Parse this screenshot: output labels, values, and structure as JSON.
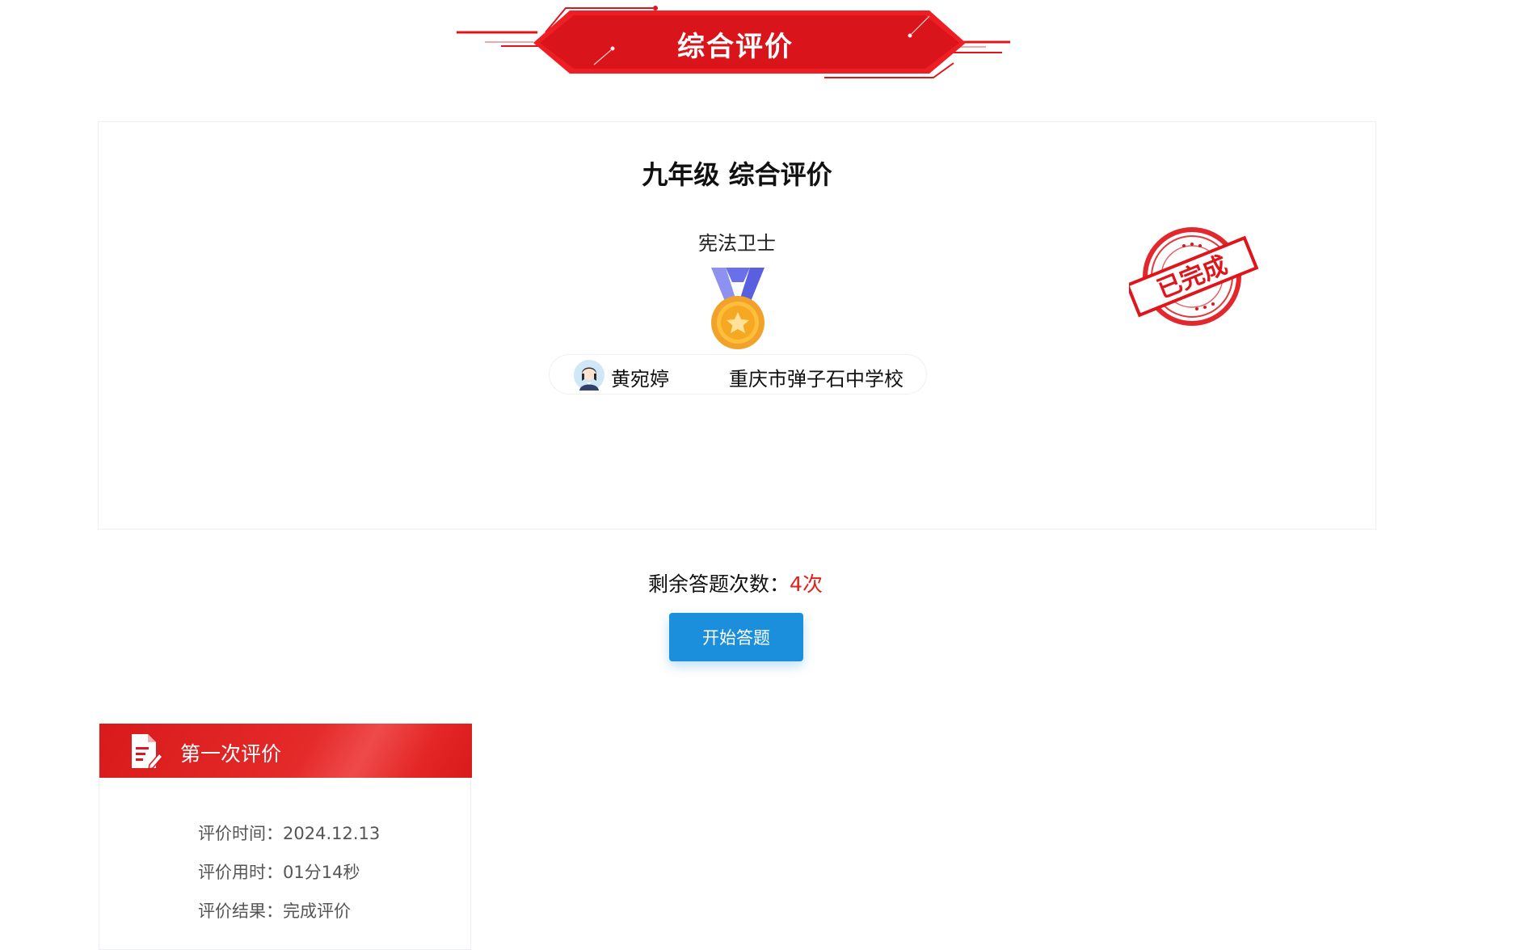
{
  "banner": {
    "title": "综合评价",
    "color": "#e0151b"
  },
  "card": {
    "title": "九年级 综合评价",
    "badge_name": "宪法卫士",
    "badge_icon": "gold-medal-icon",
    "user": {
      "avatar_icon": "student-avatar-icon",
      "name": "黄宛婷",
      "school": "重庆市弹子石中学校"
    },
    "stamp": {
      "text": "已完成",
      "color": "#e0151b"
    }
  },
  "remaining": {
    "label": "剩余答题次数：",
    "count": "4次",
    "count_color": "#e0221b"
  },
  "start_button": {
    "label": "开始答题",
    "color": "#1b8fdb"
  },
  "record": {
    "title": "第一次评价",
    "icon": "document-edit-icon",
    "rows": [
      "评价时间：2024.12.13",
      "评价用时：01分14秒",
      "评价结果：完成评价"
    ]
  }
}
